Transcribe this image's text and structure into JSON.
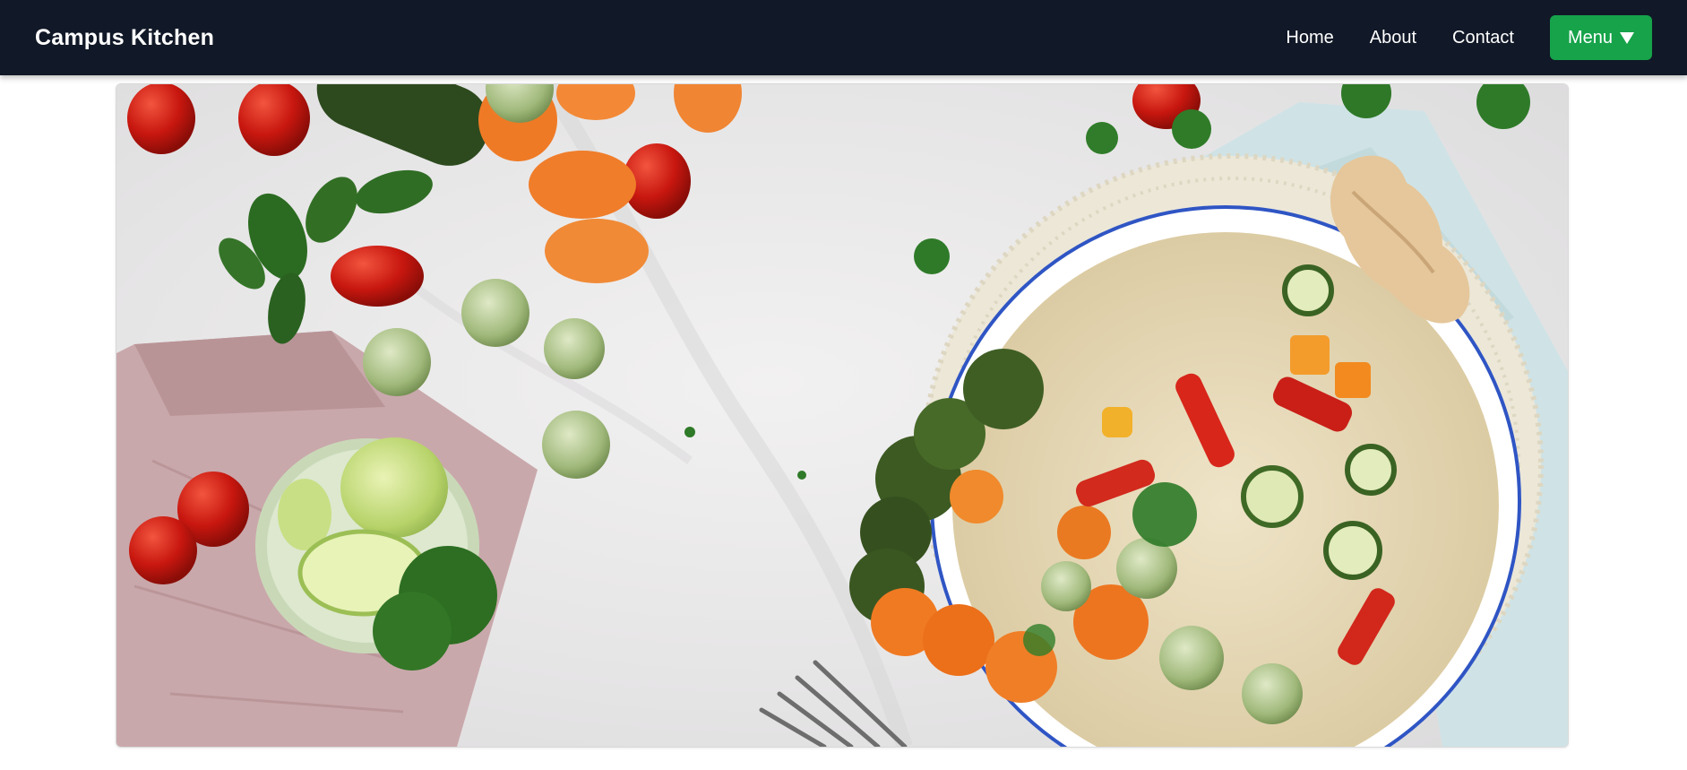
{
  "navbar": {
    "brand": "Campus Kitchen",
    "links": [
      {
        "label": "Home"
      },
      {
        "label": "About"
      },
      {
        "label": "Contact"
      }
    ],
    "menu_button": {
      "label": "Menu",
      "icon": "caret-down-icon"
    }
  },
  "hero": {
    "image": "food-flatlay-vegetable-bowl"
  },
  "colors": {
    "navbar_bg": "#111827",
    "accent": "#16a34a",
    "text_light": "#ffffff"
  }
}
